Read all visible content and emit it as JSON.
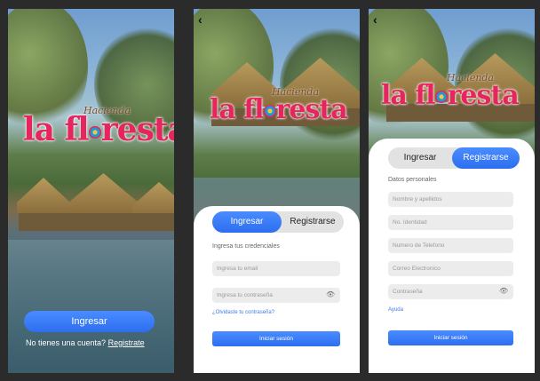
{
  "brand": {
    "small": "Hacienda",
    "main_left": "la fl",
    "main_right": "resta"
  },
  "screen1": {
    "login_button": "Ingresar",
    "no_account_text": "No tienes una cuenta?",
    "register_link": "Registrate"
  },
  "screen2": {
    "tabs": [
      "Ingresar",
      "Registrarse"
    ],
    "active_tab": "Ingresar",
    "section_label": "Ingresa tus credenciales",
    "email_placeholder": "Ingresa tu email",
    "password_placeholder": "Ingresa tu contraseña",
    "forgot_link": "¿Olvidaste tu contraseña?",
    "submit_button": "Iniciar sesión"
  },
  "screen3": {
    "tabs": [
      "Ingresar",
      "Registrarse"
    ],
    "active_tab": "Registrarse",
    "section_label": "Datos personales",
    "fields": [
      "Nombre y apellidos",
      "No. Identidad",
      "Numero de Telefono",
      "Correo Electronico",
      "Contraseña"
    ],
    "help_link": "Ayuda",
    "submit_button": "Iniciar sesión"
  },
  "icons": {
    "back": "back-arrow-icon",
    "eye": "eye-icon"
  },
  "colors": {
    "accent": "#2d6ef0",
    "brand_pink": "#e6245e",
    "field_bg": "#ececec"
  }
}
